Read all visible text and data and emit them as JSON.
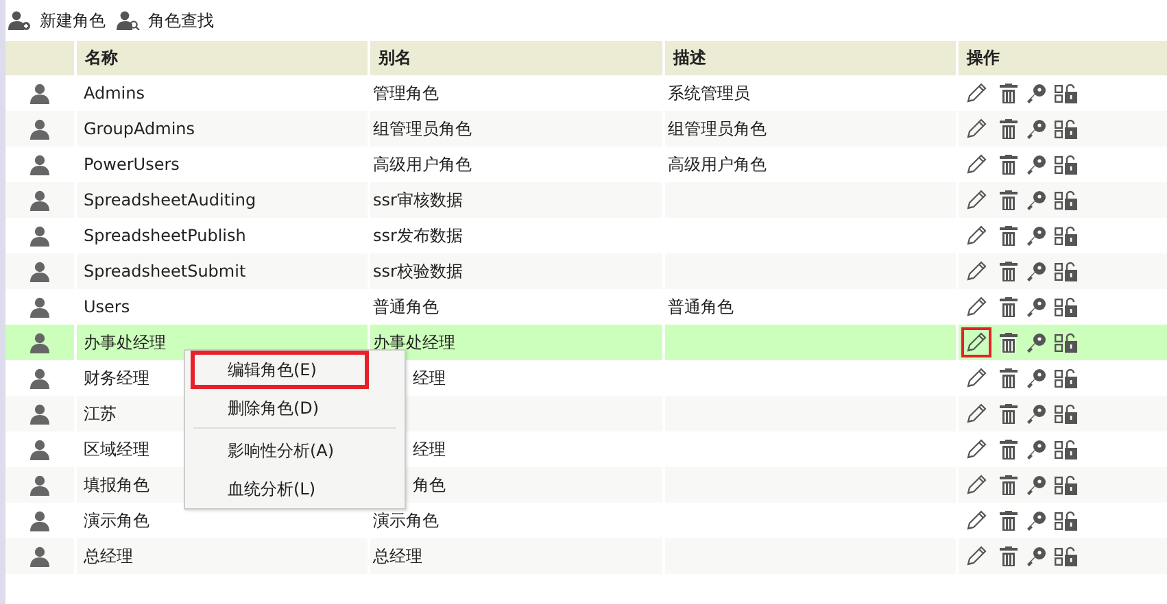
{
  "toolbar": [
    {
      "kind": "add",
      "label": "新建角色"
    },
    {
      "kind": "search",
      "label": "角色查找"
    }
  ],
  "table": {
    "columns": [
      "名称",
      "别名",
      "描述",
      "操作"
    ],
    "rows": [
      {
        "name": "Admins",
        "alias": "管理角色",
        "description": "系统管理员",
        "selected": false,
        "edit_highlighted": false
      },
      {
        "name": "GroupAdmins",
        "alias": "组管理员角色",
        "description": "组管理员角色",
        "selected": false,
        "edit_highlighted": false
      },
      {
        "name": "PowerUsers",
        "alias": "高级用户角色",
        "description": "高级用户角色",
        "selected": false,
        "edit_highlighted": false
      },
      {
        "name": "SpreadsheetAuditing",
        "alias": "ssr审核数据",
        "selected": false,
        "edit_highlighted": false
      },
      {
        "name": "SpreadsheetPublish",
        "alias": "ssr发布数据",
        "selected": false,
        "edit_highlighted": false
      },
      {
        "name": "SpreadsheetSubmit",
        "alias": "ssr校验数据",
        "selected": false,
        "edit_highlighted": false
      },
      {
        "name": "Users",
        "alias": "普通角色",
        "description": "普通角色",
        "selected": false,
        "edit_highlighted": false
      },
      {
        "name": "办事处经理",
        "alias": "办事处经理",
        "selected": true,
        "edit_highlighted": true
      },
      {
        "name": "财务经理",
        "alias": "经理",
        "selected": false,
        "alias_covered": true,
        "edit_highlighted": false
      },
      {
        "name": "江苏",
        "selected": false,
        "edit_highlighted": false
      },
      {
        "name": "区域经理",
        "alias": "经理",
        "selected": false,
        "alias_covered": true,
        "edit_highlighted": false
      },
      {
        "name": "填报角色",
        "alias": "角色",
        "selected": false,
        "alias_covered": true,
        "edit_highlighted": false
      },
      {
        "name": "演示角色",
        "alias": "演示角色",
        "selected": false,
        "edit_highlighted": false
      },
      {
        "name": "总经理",
        "alias": "总经理",
        "selected": false,
        "edit_highlighted": false
      }
    ]
  },
  "context_menu": {
    "items": [
      {
        "label": "编辑角色(E)",
        "highlighted": true
      },
      {
        "label": "删除角色(D)",
        "highlighted": false,
        "divider_after": true
      },
      {
        "label": "影响性分析(A)",
        "highlighted": false
      },
      {
        "label": "血统分析(L)",
        "highlighted": false
      }
    ]
  }
}
